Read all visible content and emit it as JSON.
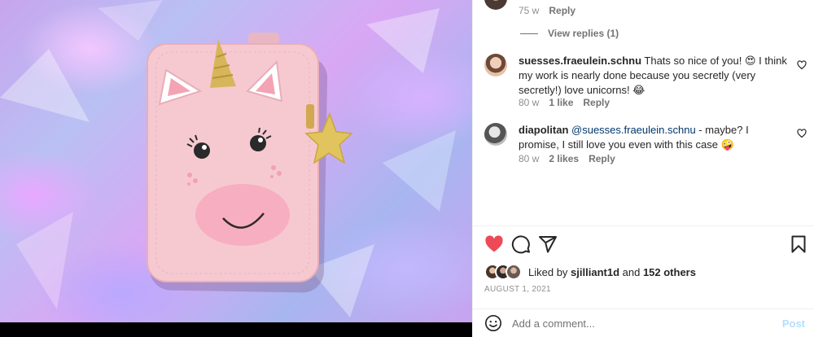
{
  "colors": {
    "liked_heart": "#ed4956",
    "link_blue": "#00376b",
    "muted_text": "#8e8e8e",
    "post_disabled": "#b2dffc"
  },
  "post_image": {
    "icon": "unicorn-pouch-photo"
  },
  "top_comment_meta": {
    "time": "75 w",
    "reply": "Reply"
  },
  "view_replies": "View replies (1)",
  "comments": [
    {
      "username": "suesses.fraeulein.schnu",
      "text": "Thats so nice of you! 😍 I think my work is nearly done because you secretly (very secretly!) love unicorns! 😂",
      "time": "80 w",
      "likes": "1 like",
      "reply": "Reply"
    },
    {
      "username": "diapolitan",
      "mention": "@suesses.fraeulein.schnu",
      "text": " - maybe? I promise, I still love you even with this case 🤪",
      "time": "80 w",
      "likes": "2 likes",
      "reply": "Reply"
    }
  ],
  "actions": {
    "like_icon": "heart-filled-icon",
    "comment_icon": "comment-icon",
    "share_icon": "share-icon",
    "save_icon": "bookmark-icon"
  },
  "likes_summary": {
    "prefix": "Liked by ",
    "user": "sjilliant1d",
    "middle": " and ",
    "others": "152 others"
  },
  "post_date": "AUGUST 1, 2021",
  "comment_box": {
    "placeholder": "Add a comment...",
    "post_label": "Post"
  }
}
